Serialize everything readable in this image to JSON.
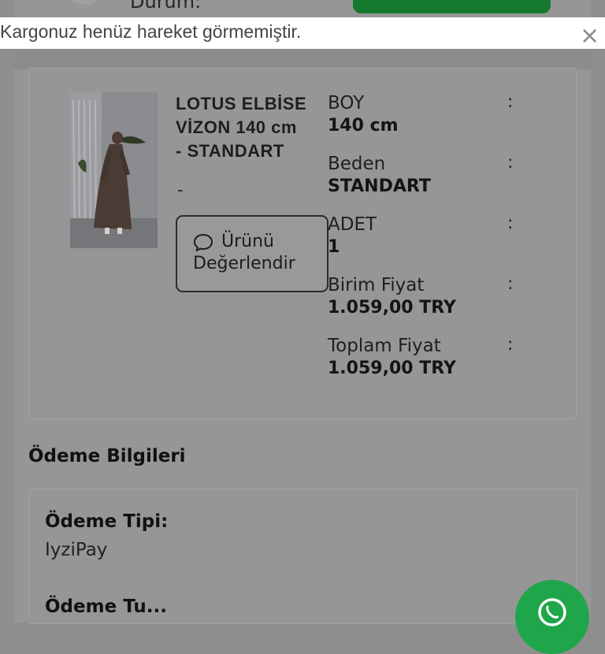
{
  "header": {
    "status_label": "Durum:"
  },
  "toast": {
    "message": "Kargonuz henüz hareket görmemiştir.",
    "close_glyph": "×"
  },
  "product": {
    "title_line1": "LOTUS ELBİSE",
    "title_line2": "VİZON 140 cm",
    "title_line3": "- STANDART",
    "dash": "-",
    "review_button": {
      "line1": "Ürünü",
      "line2": "Değerlendir",
      "icon": "chat-bubble-icon"
    },
    "attributes": [
      {
        "label": "BOY",
        "value": "140 cm"
      },
      {
        "label": "Beden",
        "value": "STANDART"
      },
      {
        "label": "ADET",
        "value": "1"
      },
      {
        "label": "Birim Fiyat",
        "value": "1.059,00 TRY"
      },
      {
        "label": "Toplam Fiyat",
        "value": "1.059,00 TRY"
      }
    ],
    "colon": ":"
  },
  "payment": {
    "section_title": "Ödeme Bilgileri",
    "type_label": "Ödeme Tipi:",
    "type_value": "IyziPay",
    "next_label": "Ödeme Tu..."
  },
  "floating": {
    "whatsapp_icon": "whatsapp-icon"
  },
  "colors": {
    "overlay_gray": "#8e8e8e",
    "green_button": "#157a2e",
    "whatsapp": "#1fa64a",
    "toast_bg": "#ffffff"
  }
}
